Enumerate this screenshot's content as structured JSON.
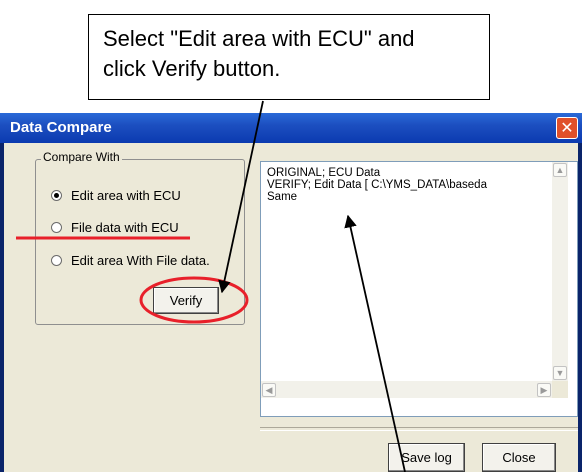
{
  "callout": {
    "line1": "Select \"Edit area with ECU\" and",
    "line2": "click Verify button."
  },
  "dialog": {
    "title": "Data Compare",
    "close_glyph": "✕",
    "group_label": "Compare With",
    "options": [
      {
        "label": "Edit area with ECU",
        "checked": true
      },
      {
        "label": "File data with ECU",
        "checked": false
      },
      {
        "label": "Edit area With File data.",
        "checked": false
      }
    ],
    "verify_label": "Verify",
    "output_text": "ORIGINAL; ECU Data\nVERIFY; Edit Data [ C:\\YMS_DATA\\baseda\nSame",
    "save_log_label": "Save log",
    "close_label": "Close"
  },
  "colors": {
    "annotation_red": "#e8202a",
    "title_blue": "#1c4fc0",
    "client_bg": "#ece9d8"
  }
}
